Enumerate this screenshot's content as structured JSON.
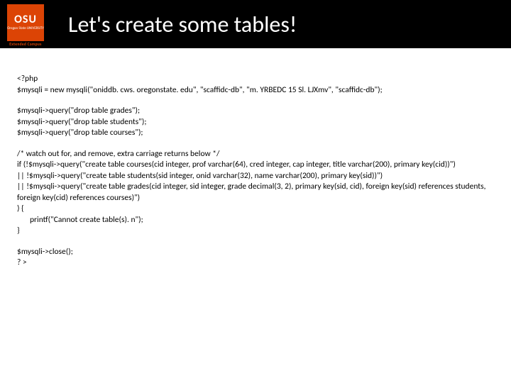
{
  "logo": {
    "text": "OSU",
    "subtext": "Oregon State\nUNIVERSITY",
    "tagline": "Extended Campus"
  },
  "title": "Let's create some tables!",
  "code": {
    "p1_l1": "<?php",
    "p1_l2": "$mysqli = new mysqli(\"oniddb. cws. oregonstate. edu\", \"scaffidc-db\", \"m. YRBEDC 15 Sl. LJXmv\", \"scaffidc-db\");",
    "p2_l1": "$mysqli->query(\"drop table grades\");",
    "p2_l2": "$mysqli->query(\"drop table students\");",
    "p2_l3": "$mysqli->query(\"drop table courses\");",
    "p3_l1": "/* watch out for, and remove, extra carriage returns below */",
    "p3_l2": "if (!$mysqli->query(\"create table courses(cid integer, prof varchar(64), cred integer, cap integer, title varchar(200), primary key(cid))\")",
    "p3_l3": " || !$mysqli->query(\"create table students(sid integer, onid varchar(32), name varchar(200), primary key(sid))\")",
    "p3_l4": " || !$mysqli->query(\"create table grades(cid integer, sid integer, grade decimal(3, 2), primary key(sid, cid), foreign key(sid) references students, foreign key(cid) references courses)\")",
    "p3_l5": " ) {",
    "p3_l6": "printf(\"Cannot create table(s). n\");",
    "p3_l7": "}",
    "p4_l1": "$mysqli->close();",
    "p4_l2": "? >"
  }
}
